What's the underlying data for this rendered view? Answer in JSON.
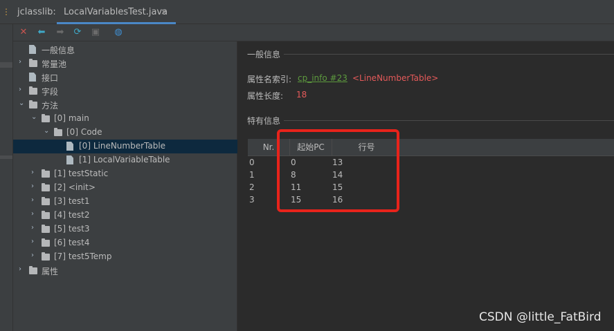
{
  "header": {
    "tool_name": "jclasslib:",
    "tab_title": "LocalVariablesTest.java",
    "close_glyph": "×"
  },
  "toolbar": {
    "buttons": [
      {
        "name": "close-icon",
        "glyph": "✕",
        "color": "#c75450"
      },
      {
        "name": "back-icon",
        "glyph": "⬅",
        "color": "#3fa9c8"
      },
      {
        "name": "forward-icon",
        "glyph": "➡",
        "color": "#6b6b6b"
      },
      {
        "name": "refresh-icon",
        "glyph": "⟳",
        "color": "#3fa9c8"
      },
      {
        "name": "save-icon",
        "glyph": "▣",
        "color": "#6b6b6b"
      },
      {
        "name": "browser-icon",
        "glyph": "◍",
        "color": "#3f8fd2"
      }
    ]
  },
  "tree": {
    "items": [
      {
        "label": "一般信息",
        "type": "file",
        "arrow": ""
      },
      {
        "label": "常量池",
        "type": "folder",
        "arrow": "›"
      },
      {
        "label": "接口",
        "type": "file",
        "arrow": ""
      },
      {
        "label": "字段",
        "type": "folder",
        "arrow": "›"
      },
      {
        "label": "方法",
        "type": "folder",
        "arrow": "⌄"
      },
      {
        "label": "[0] main",
        "type": "folder",
        "arrow": "⌄"
      },
      {
        "label": "[0] Code",
        "type": "folder",
        "arrow": "⌄"
      },
      {
        "label": "[0] LineNumberTable",
        "type": "file",
        "arrow": ""
      },
      {
        "label": "[1] LocalVariableTable",
        "type": "file",
        "arrow": ""
      },
      {
        "label": "[1] testStatic",
        "type": "folder",
        "arrow": "›"
      },
      {
        "label": "[2] <init>",
        "type": "folder",
        "arrow": "›"
      },
      {
        "label": "[3] test1",
        "type": "folder",
        "arrow": "›"
      },
      {
        "label": "[4] test2",
        "type": "folder",
        "arrow": "›"
      },
      {
        "label": "[5] test3",
        "type": "folder",
        "arrow": "›"
      },
      {
        "label": "[6] test4",
        "type": "folder",
        "arrow": "›"
      },
      {
        "label": "[7] test5Temp",
        "type": "folder",
        "arrow": "›"
      },
      {
        "label": "属性",
        "type": "folder",
        "arrow": "›"
      }
    ]
  },
  "general": {
    "section_title": "一般信息",
    "name_index_label": "属性名索引:",
    "name_index_link": "cp_info #23",
    "name_index_value": "<LineNumberTable>",
    "length_label": "属性长度:",
    "length_value": "18"
  },
  "specific": {
    "section_title": "特有信息",
    "columns": [
      "Nr.",
      "起始PC",
      "行号"
    ],
    "rows": [
      [
        "0",
        "0",
        "13"
      ],
      [
        "1",
        "8",
        "14"
      ],
      [
        "2",
        "11",
        "15"
      ],
      [
        "3",
        "15",
        "16"
      ]
    ]
  },
  "watermark": "CSDN @little_FatBird",
  "colors": {
    "accent": "#4a88c7",
    "selection": "#0d293e",
    "link": "#5d9b3e",
    "error_red": "#e55a5a",
    "highlight_box": "#e8231b"
  }
}
